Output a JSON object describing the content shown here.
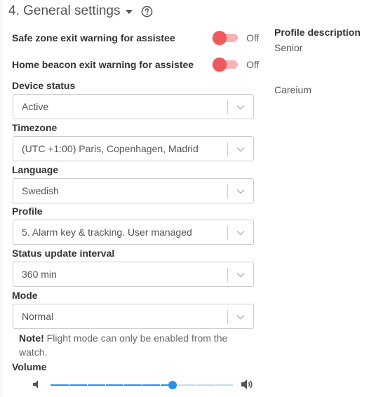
{
  "section": {
    "title": "4. General settings"
  },
  "toggles": [
    {
      "label": "Safe zone exit warning for assistee",
      "state": "Off"
    },
    {
      "label": "Home beacon exit warning for assistee",
      "state": "Off"
    }
  ],
  "fields": {
    "device_status": {
      "label": "Device status",
      "value": "Active"
    },
    "timezone": {
      "label": "Timezone",
      "value": "(UTC +1:00) Paris, Copenhagen, Madrid"
    },
    "language": {
      "label": "Language",
      "value": "Swedish"
    },
    "profile": {
      "label": "Profile",
      "value": "5. Alarm key & tracking. User managed"
    },
    "status_interval": {
      "label": "Status update interval",
      "value": "360 min"
    },
    "mode": {
      "label": "Mode",
      "value": "Normal"
    }
  },
  "note": {
    "bold": "Note!",
    "text": " Flight mode can only be enabled from the watch."
  },
  "volume": {
    "label": "Volume",
    "level": 0.67,
    "steps": 10
  },
  "profile_description": {
    "title": "Profile description",
    "lines": [
      "Senior",
      "Careium"
    ]
  },
  "colors": {
    "toggle_thumb": "#ec5a5e",
    "toggle_track": "#f7b3b4",
    "slider": "#2c8fe6"
  },
  "icons": {
    "help": "help-circle-icon",
    "caret": "caret-down-icon",
    "chevron": "chevron-down-icon",
    "volume_low": "volume-low-icon",
    "volume_high": "volume-high-icon"
  }
}
